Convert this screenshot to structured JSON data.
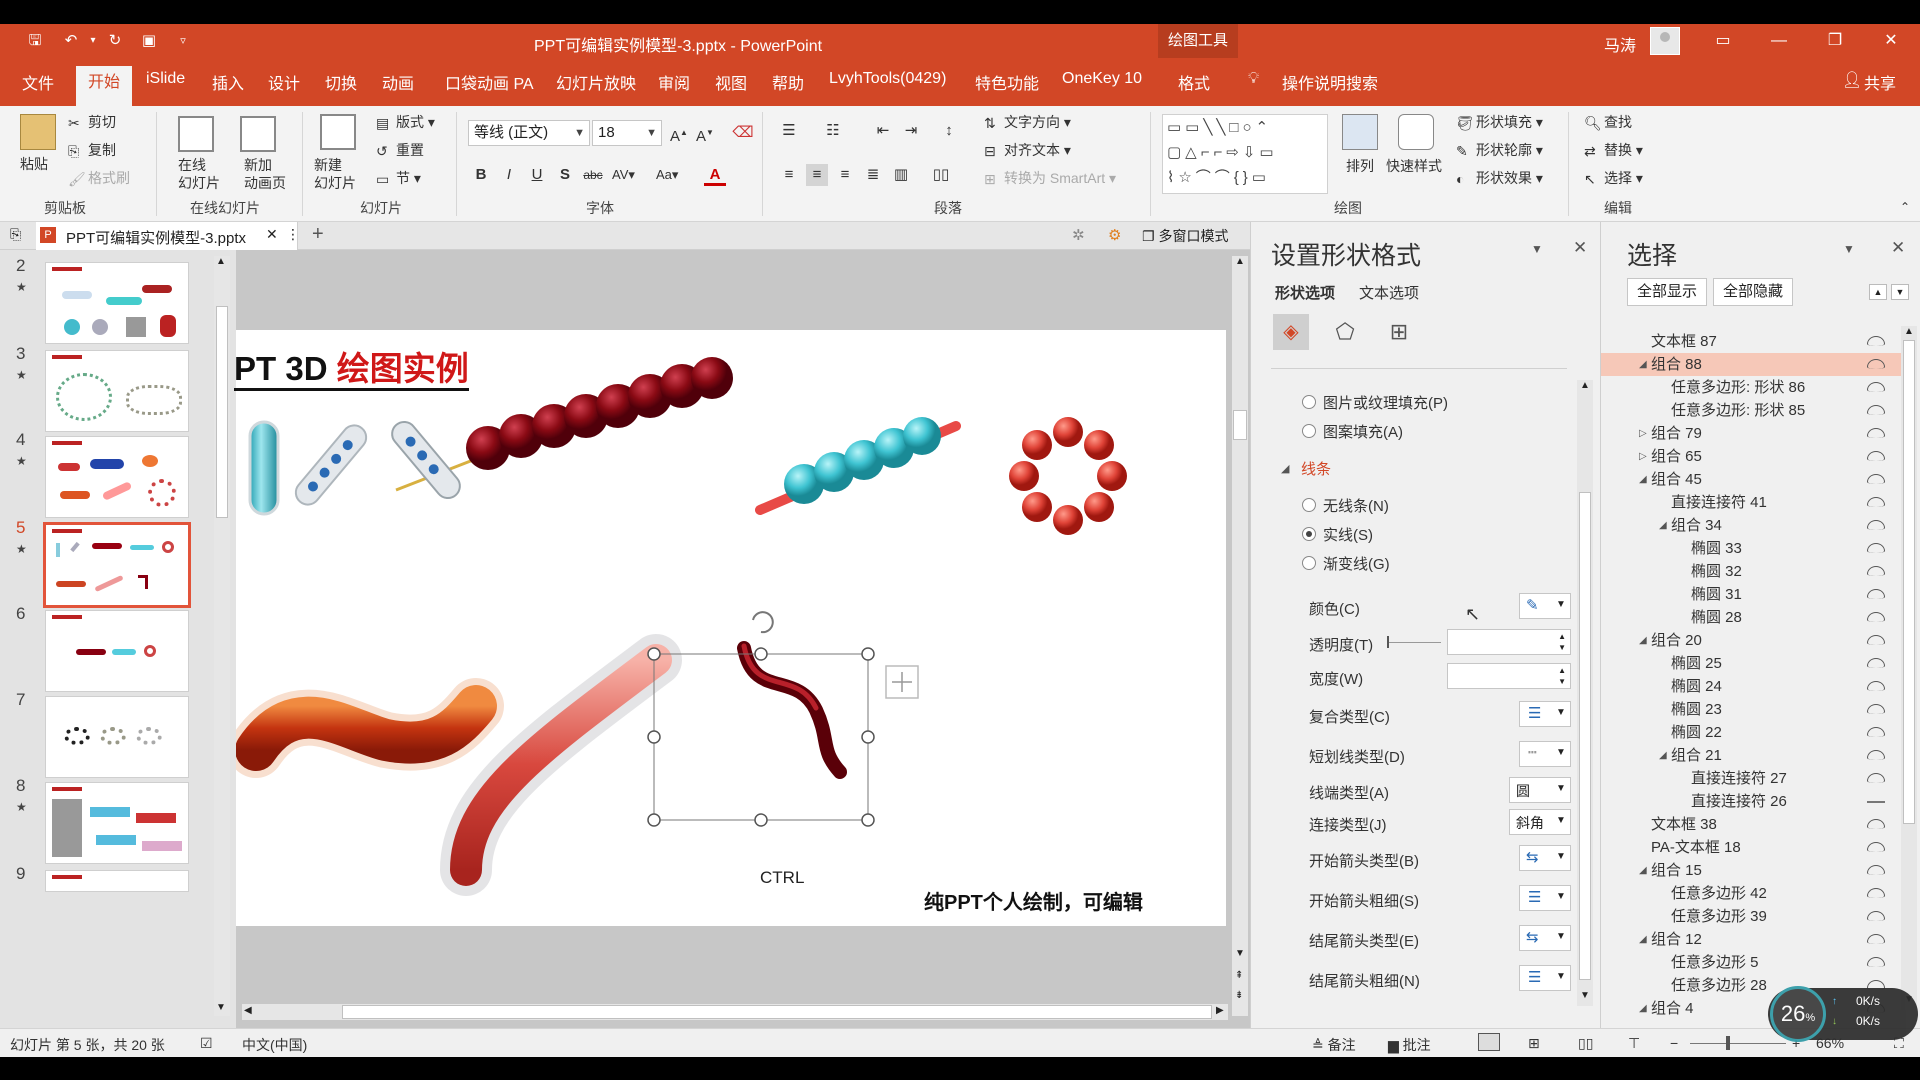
{
  "window": {
    "title": "PPT可编辑实例模型-3.pptx  -  PowerPoint",
    "tools_label": "绘图工具",
    "user": "马涛",
    "accent": "#d24726"
  },
  "tabs": [
    "文件",
    "开始",
    "iSlide",
    "插入",
    "设计",
    "切换",
    "动画",
    "口袋动画 PA",
    "幻灯片放映",
    "审阅",
    "视图",
    "帮助",
    "LvyhTools(0429)",
    "特色功能",
    "OneKey 10",
    "格式"
  ],
  "tell_me": "操作说明搜索",
  "share": "共享",
  "ribbon": {
    "clipboard": {
      "paste": "粘贴",
      "cut": "剪切",
      "copy": "复制",
      "format_painter": "格式刷",
      "group": "剪贴板"
    },
    "online": {
      "online_slides": "在线\n幻灯片",
      "new_anim": "新加\n动画页",
      "group": "在线幻灯片"
    },
    "slides": {
      "new_slide": "新建\n幻灯片",
      "layout": "版式",
      "reset": "重置",
      "section": "节",
      "group": "幻灯片"
    },
    "font": {
      "name": "等线 (正文)",
      "size": "18",
      "group": "字体"
    },
    "paragraph": {
      "text_dir": "文字方向",
      "align_text": "对齐文本",
      "smartart": "转换为 SmartArt",
      "group": "段落"
    },
    "drawing": {
      "arrange": "排列",
      "quick_styles": "快速样式",
      "shape_fill": "形状填充",
      "shape_outline": "形状轮廓",
      "shape_effects": "形状效果",
      "group": "绘图"
    },
    "editing": {
      "find": "查找",
      "replace": "替换",
      "select": "选择",
      "group": "编辑"
    }
  },
  "doc_tab": {
    "name": "PPT可编辑实例模型-3.pptx",
    "multi_window": "多窗口模式"
  },
  "thumbnails": [
    {
      "num": "2",
      "star": "★"
    },
    {
      "num": "3",
      "star": "★"
    },
    {
      "num": "4",
      "star": "★"
    },
    {
      "num": "5",
      "star": "★"
    },
    {
      "num": "6",
      "star": ""
    },
    {
      "num": "7",
      "star": ""
    },
    {
      "num": "8",
      "star": "★"
    },
    {
      "num": "9",
      "star": ""
    }
  ],
  "slide": {
    "title_prefix": "PT 3D ",
    "title_highlight": "绘图实例",
    "ctrl_label": "CTRL",
    "caption": "纯PPT个人绘制，可编辑"
  },
  "format_pane": {
    "title": "设置形状格式",
    "tab_shape": "形状选项",
    "tab_text": "文本选项",
    "fill_picture": "图片或纹理填充(P)",
    "fill_pattern": "图案填充(A)",
    "line_section": "线条",
    "no_line": "无线条(N)",
    "solid_line": "实线(S)",
    "gradient_line": "渐变线(G)",
    "color": "颜色(C)",
    "transparency": "透明度(T)",
    "width": "宽度(W)",
    "compound": "复合类型(C)",
    "dash": "短划线类型(D)",
    "cap": "线端类型(A)",
    "cap_value": "圆",
    "join": "连接类型(J)",
    "join_value": "斜角",
    "begin_arrow_type": "开始箭头类型(B)",
    "begin_arrow_size": "开始箭头粗细(S)",
    "end_arrow_type": "结尾箭头类型(E)",
    "end_arrow_size": "结尾箭头粗细(N)"
  },
  "selection_pane": {
    "title": "选择",
    "show_all": "全部显示",
    "hide_all": "全部隐藏",
    "items": [
      {
        "label": "文本框 87",
        "level": 0,
        "caret": ""
      },
      {
        "label": "组合 88",
        "level": 0,
        "caret": "◢",
        "selected": true
      },
      {
        "label": "任意多边形: 形状 86",
        "level": 1,
        "caret": ""
      },
      {
        "label": "任意多边形: 形状 85",
        "level": 1,
        "caret": ""
      },
      {
        "label": "组合 79",
        "level": 0,
        "caret": "▷"
      },
      {
        "label": "组合 65",
        "level": 0,
        "caret": "▷"
      },
      {
        "label": "组合 45",
        "level": 0,
        "caret": "◢"
      },
      {
        "label": "直接连接符 41",
        "level": 1,
        "caret": ""
      },
      {
        "label": "组合 34",
        "level": 1,
        "caret": "◢"
      },
      {
        "label": "椭圆 33",
        "level": 2,
        "caret": ""
      },
      {
        "label": "椭圆 32",
        "level": 2,
        "caret": ""
      },
      {
        "label": "椭圆 31",
        "level": 2,
        "caret": ""
      },
      {
        "label": "椭圆 28",
        "level": 2,
        "caret": ""
      },
      {
        "label": "组合 20",
        "level": 0,
        "caret": "◢"
      },
      {
        "label": "椭圆 25",
        "level": 1,
        "caret": ""
      },
      {
        "label": "椭圆 24",
        "level": 1,
        "caret": ""
      },
      {
        "label": "椭圆 23",
        "level": 1,
        "caret": ""
      },
      {
        "label": "椭圆 22",
        "level": 1,
        "caret": ""
      },
      {
        "label": "组合 21",
        "level": 1,
        "caret": "◢"
      },
      {
        "label": "直接连接符 27",
        "level": 2,
        "caret": ""
      },
      {
        "label": "直接连接符 26",
        "level": 2,
        "caret": "",
        "hidden": true
      },
      {
        "label": "文本框 38",
        "level": 0,
        "caret": ""
      },
      {
        "label": "PA-文本框 18",
        "level": 0,
        "caret": ""
      },
      {
        "label": "组合 15",
        "level": 0,
        "caret": "◢"
      },
      {
        "label": "任意多边形 42",
        "level": 1,
        "caret": ""
      },
      {
        "label": "任意多边形 39",
        "level": 1,
        "caret": ""
      },
      {
        "label": "组合 12",
        "level": 0,
        "caret": "◢"
      },
      {
        "label": "任意多边形 5",
        "level": 1,
        "caret": ""
      },
      {
        "label": "任意多边形 28",
        "level": 1,
        "caret": ""
      },
      {
        "label": "组合 4",
        "level": 0,
        "caret": "◢"
      }
    ]
  },
  "status": {
    "slide_info": "幻灯片 第 5 张，共 20 张",
    "language": "中文(中国)",
    "notes": "备注",
    "comments": "批注",
    "zoom": "66%",
    "cpu": "26",
    "net_up": "0K/s",
    "net_down": "0K/s"
  }
}
